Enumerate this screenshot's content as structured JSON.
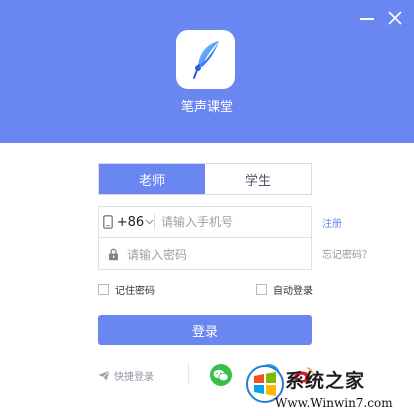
{
  "window": {
    "minimize_icon": "minimize-icon",
    "close_icon": "close-icon"
  },
  "header": {
    "app_name": "笔声课堂",
    "logo_icon": "feather-pen-icon",
    "background": "#6a86f1"
  },
  "tabs": [
    {
      "label": "老师",
      "active": true
    },
    {
      "label": "学生",
      "active": false
    }
  ],
  "form": {
    "country_code": "+86",
    "phone_placeholder": "请输入手机号",
    "phone_value": "",
    "password_placeholder": "请输入密码",
    "password_value": ""
  },
  "links": {
    "register": "注册",
    "forgot_password": "忘记密码？"
  },
  "options": {
    "remember_password": "记住密码",
    "remember_checked": false,
    "auto_login": "自动登录",
    "auto_checked": false
  },
  "login_button": "登录",
  "quick_login": "快捷登录",
  "social_icons": [
    "wechat-icon",
    "qq-icon",
    "weibo-icon"
  ],
  "watermark": {
    "title": "系统之家",
    "url": "Www.Winwin7.com"
  },
  "colors": {
    "accent": "#6a86f1",
    "text": "#333333",
    "muted": "#8f96a3",
    "border": "#dcdfe6"
  }
}
